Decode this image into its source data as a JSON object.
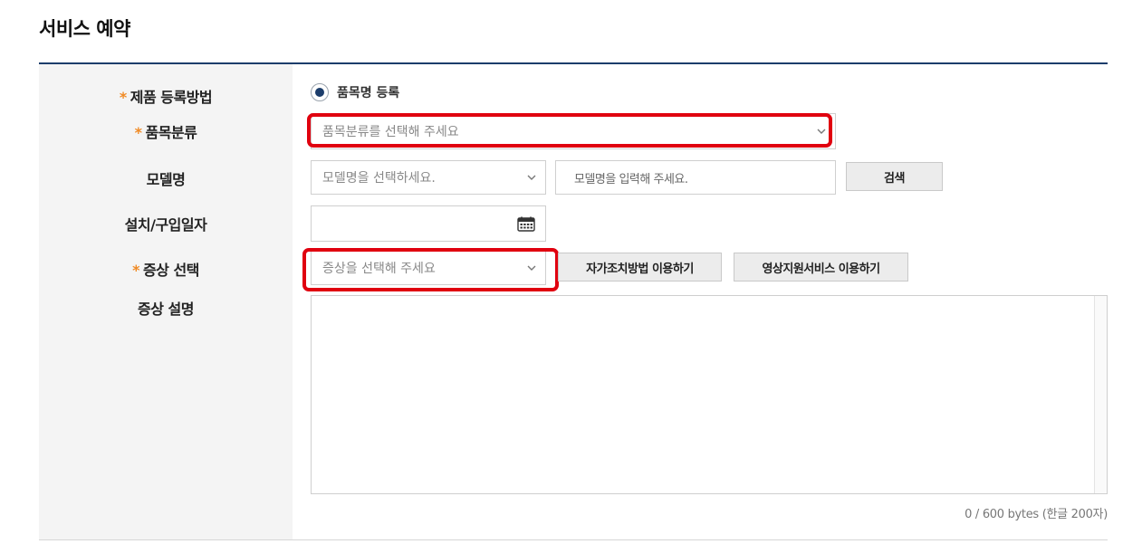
{
  "page": {
    "title": "서비스 예약"
  },
  "form": {
    "required_mark": "*",
    "labels": {
      "registration_method": "제품 등록방법",
      "category": "품목분류",
      "model": "모델명",
      "install_date": "설치/구입일자",
      "symptom": "증상 선택",
      "symptom_desc": "증상 설명"
    },
    "registration_option": {
      "label": "품목명 등록",
      "selected": true
    },
    "category_select": {
      "placeholder": "품목분류를 선택해 주세요"
    },
    "model_select": {
      "placeholder": "모델명을 선택하세요."
    },
    "model_input": {
      "placeholder": "모델명을 입력해 주세요."
    },
    "search_button": "검색",
    "symptom_select": {
      "placeholder": "증상을 선택해 주세요"
    },
    "self_fix_button": "자가조치방법 이용하기",
    "video_support_button": "영상지원서비스 이용하기",
    "description": {
      "value": "",
      "counter": "0 / 600 bytes (한글 200자)"
    }
  },
  "icons": {
    "calendar": "calendar-icon",
    "chevron": "chevron-down-icon"
  },
  "colors": {
    "accent": "#1c3d6b",
    "required": "#f08a24",
    "highlight": "#e0000f"
  }
}
